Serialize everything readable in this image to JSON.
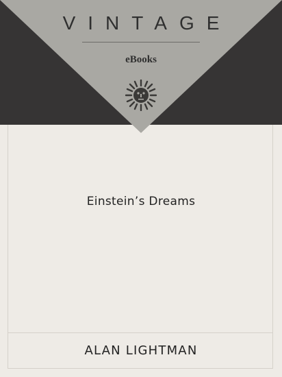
{
  "cover": {
    "publisher": "VINTAGE",
    "imprint": "eBooks",
    "title": "Einstein’s Dreams",
    "author": "ALAN LIGHTMAN",
    "logo_icon": "sun-face-icon"
  },
  "colors": {
    "band": "#363434",
    "triangle": "#a9a8a3",
    "background": "#eeebe6",
    "text": "#222222"
  }
}
